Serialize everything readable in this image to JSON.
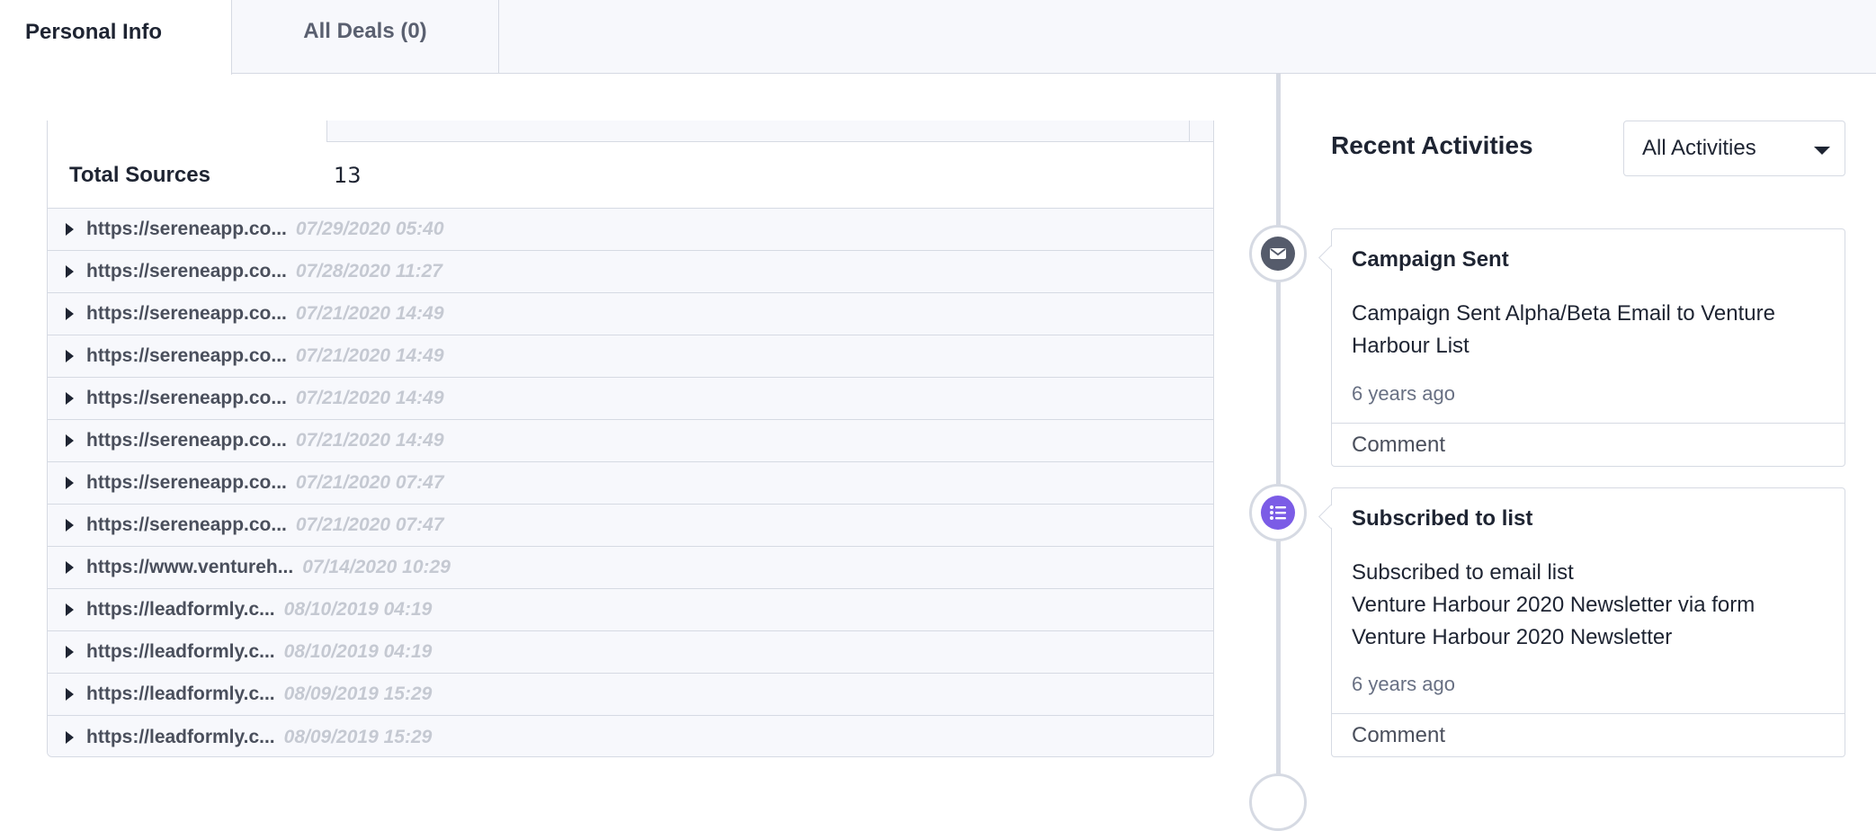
{
  "tabs": [
    {
      "label": "Personal Info",
      "active": true
    },
    {
      "label": "All Deals (0)",
      "active": false
    }
  ],
  "sources": {
    "total_label": "Total Sources",
    "total_value": "13",
    "rows": [
      {
        "url": "https://sereneapp.co...",
        "date": "07/29/2020 05:40"
      },
      {
        "url": "https://sereneapp.co...",
        "date": "07/28/2020 11:27"
      },
      {
        "url": "https://sereneapp.co...",
        "date": "07/21/2020 14:49"
      },
      {
        "url": "https://sereneapp.co...",
        "date": "07/21/2020 14:49"
      },
      {
        "url": "https://sereneapp.co...",
        "date": "07/21/2020 14:49"
      },
      {
        "url": "https://sereneapp.co...",
        "date": "07/21/2020 14:49"
      },
      {
        "url": "https://sereneapp.co...",
        "date": "07/21/2020 07:47"
      },
      {
        "url": "https://sereneapp.co...",
        "date": "07/21/2020 07:47"
      },
      {
        "url": "https://www.ventureh...",
        "date": "07/14/2020 10:29"
      },
      {
        "url": "https://leadformly.c...",
        "date": "08/10/2019 04:19"
      },
      {
        "url": "https://leadformly.c...",
        "date": "08/10/2019 04:19"
      },
      {
        "url": "https://leadformly.c...",
        "date": "08/09/2019 15:29"
      },
      {
        "url": "https://leadformly.c...",
        "date": "08/09/2019 15:29"
      }
    ]
  },
  "activities": {
    "title": "Recent Activities",
    "filter_value": "All Activities",
    "items": [
      {
        "icon": "mail-icon",
        "title": "Campaign Sent",
        "body_lines": [
          "Campaign Sent Alpha/Beta Email to Venture",
          "Harbour List"
        ],
        "time": "6 years ago",
        "comment": "Comment"
      },
      {
        "icon": "list-icon",
        "title": "Subscribed to list",
        "body_lines": [
          "Subscribed to email list",
          "Venture Harbour 2020 Newsletter via form",
          "Venture Harbour 2020 Newsletter"
        ],
        "time": "6 years ago",
        "comment": "Comment"
      }
    ]
  },
  "colors": {
    "accent_purple": "#7b5ce6",
    "icon_gray": "#555b6b",
    "border": "#d6dae3",
    "muted_date": "#c5c9d2"
  }
}
